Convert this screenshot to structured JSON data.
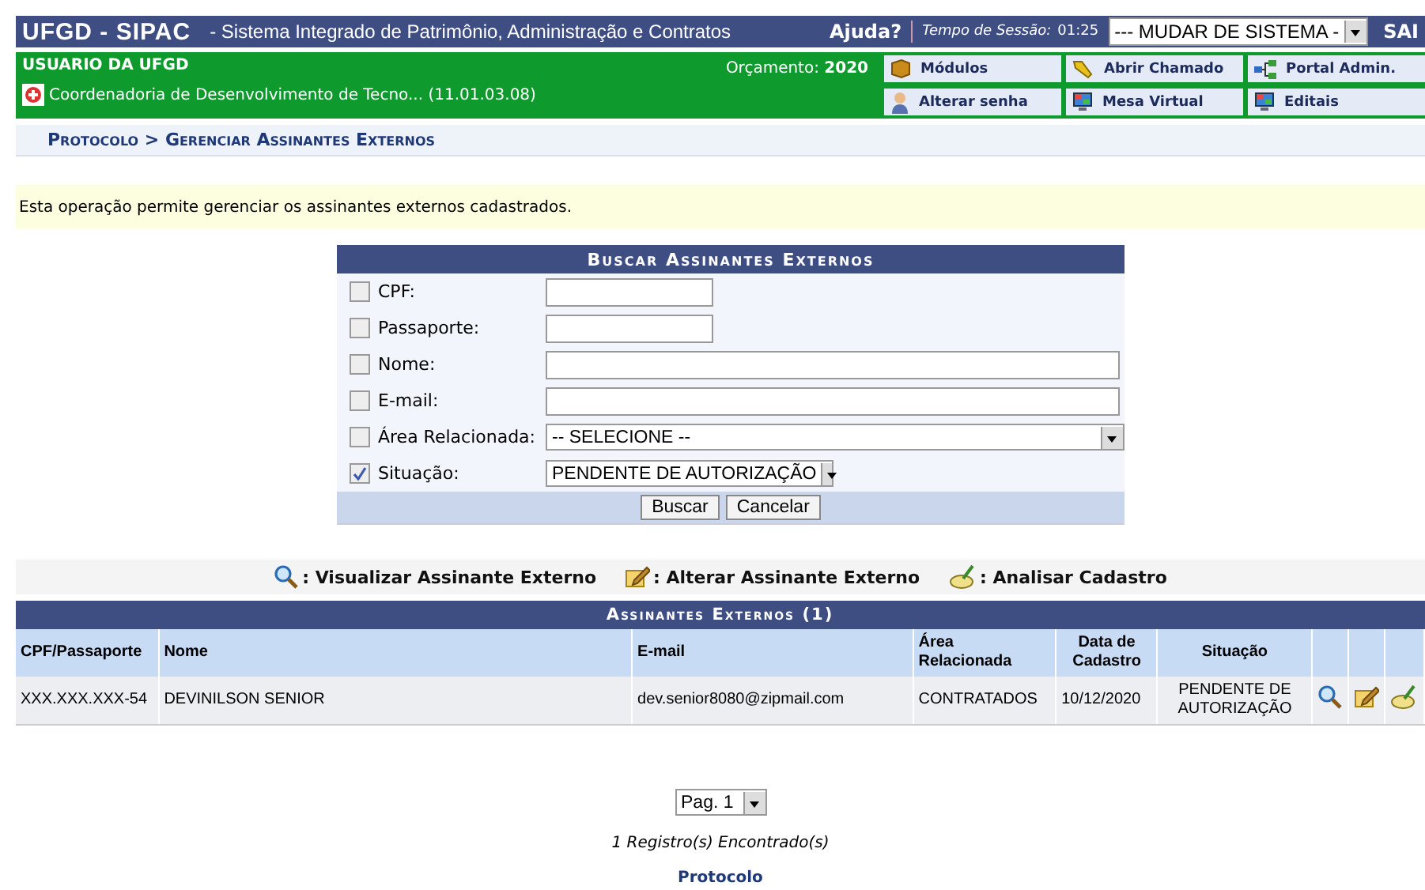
{
  "header": {
    "title": "UFGD - SIPAC",
    "subtitle": "- Sistema Integrado de Patrimônio, Administração e Contratos",
    "help": "Ajuda?",
    "session_label": "Tempo de Sessão:",
    "session_time": "01:25",
    "system_select": "--- MUDAR DE SISTEMA -",
    "exit": "SAI"
  },
  "user_bar": {
    "user": "USUARIO DA UFGD",
    "unit": "Coordenadoria de Desenvolvimento de Tecno... (11.01.03.08)",
    "budget_label": "Orçamento:",
    "budget_year": "2020",
    "links": [
      {
        "label": "Módulos",
        "kind": "box"
      },
      {
        "label": "Abrir Chamado",
        "kind": "flash"
      },
      {
        "label": "Portal Admin.",
        "kind": "tree"
      },
      {
        "label": "Alterar senha",
        "kind": "person"
      },
      {
        "label": "Mesa Virtual",
        "kind": "monitor"
      },
      {
        "label": "Editais",
        "kind": "monitor"
      }
    ]
  },
  "breadcrumb": "Protocolo > Gerenciar Assinantes Externos",
  "info": "Esta operação permite gerenciar os assinantes externos cadastrados.",
  "search_form": {
    "title": "Buscar Assinantes Externos",
    "fields": [
      {
        "label": "CPF:",
        "checked": false,
        "kind": "short"
      },
      {
        "label": "Passaporte:",
        "checked": false,
        "kind": "short"
      },
      {
        "label": "Nome:",
        "checked": false,
        "kind": "long"
      },
      {
        "label": "E-mail:",
        "checked": false,
        "kind": "long"
      },
      {
        "label": "Área Relacionada:",
        "checked": false,
        "kind": "select",
        "value": "-- SELECIONE --"
      },
      {
        "label": "Situação:",
        "checked": true,
        "kind": "select_short",
        "value": "PENDENTE DE AUTORIZAÇÃO"
      }
    ],
    "buttons": [
      "Buscar",
      "Cancelar"
    ]
  },
  "legend": [
    {
      "label": ": Visualizar Assinante Externo",
      "kind": "view"
    },
    {
      "label": ": Alterar Assinante Externo",
      "kind": "edit"
    },
    {
      "label": ": Analisar Cadastro",
      "kind": "analyze"
    }
  ],
  "table": {
    "title": "Assinantes Externos (1)",
    "columns": [
      "CPF/Passaporte",
      "Nome",
      "E-mail",
      "Área Relacionada",
      "Data de Cadastro",
      "Situação"
    ],
    "rows": [
      {
        "cells": [
          "XXX.XXX.XXX-54",
          "DEVINILSON SENIOR",
          "dev.senior8080@zipmail.com",
          "CONTRATADOS",
          "10/12/2020",
          "PENDENTE DE AUTORIZAÇÃO"
        ],
        "actions": [
          {
            "kind": "view"
          },
          {
            "kind": "edit"
          },
          {
            "kind": "analyze"
          }
        ]
      }
    ]
  },
  "pagination": {
    "page": "Pag. 1",
    "count": "1 Registro(s) Encontrado(s)"
  },
  "footer_link": "Protocolo"
}
